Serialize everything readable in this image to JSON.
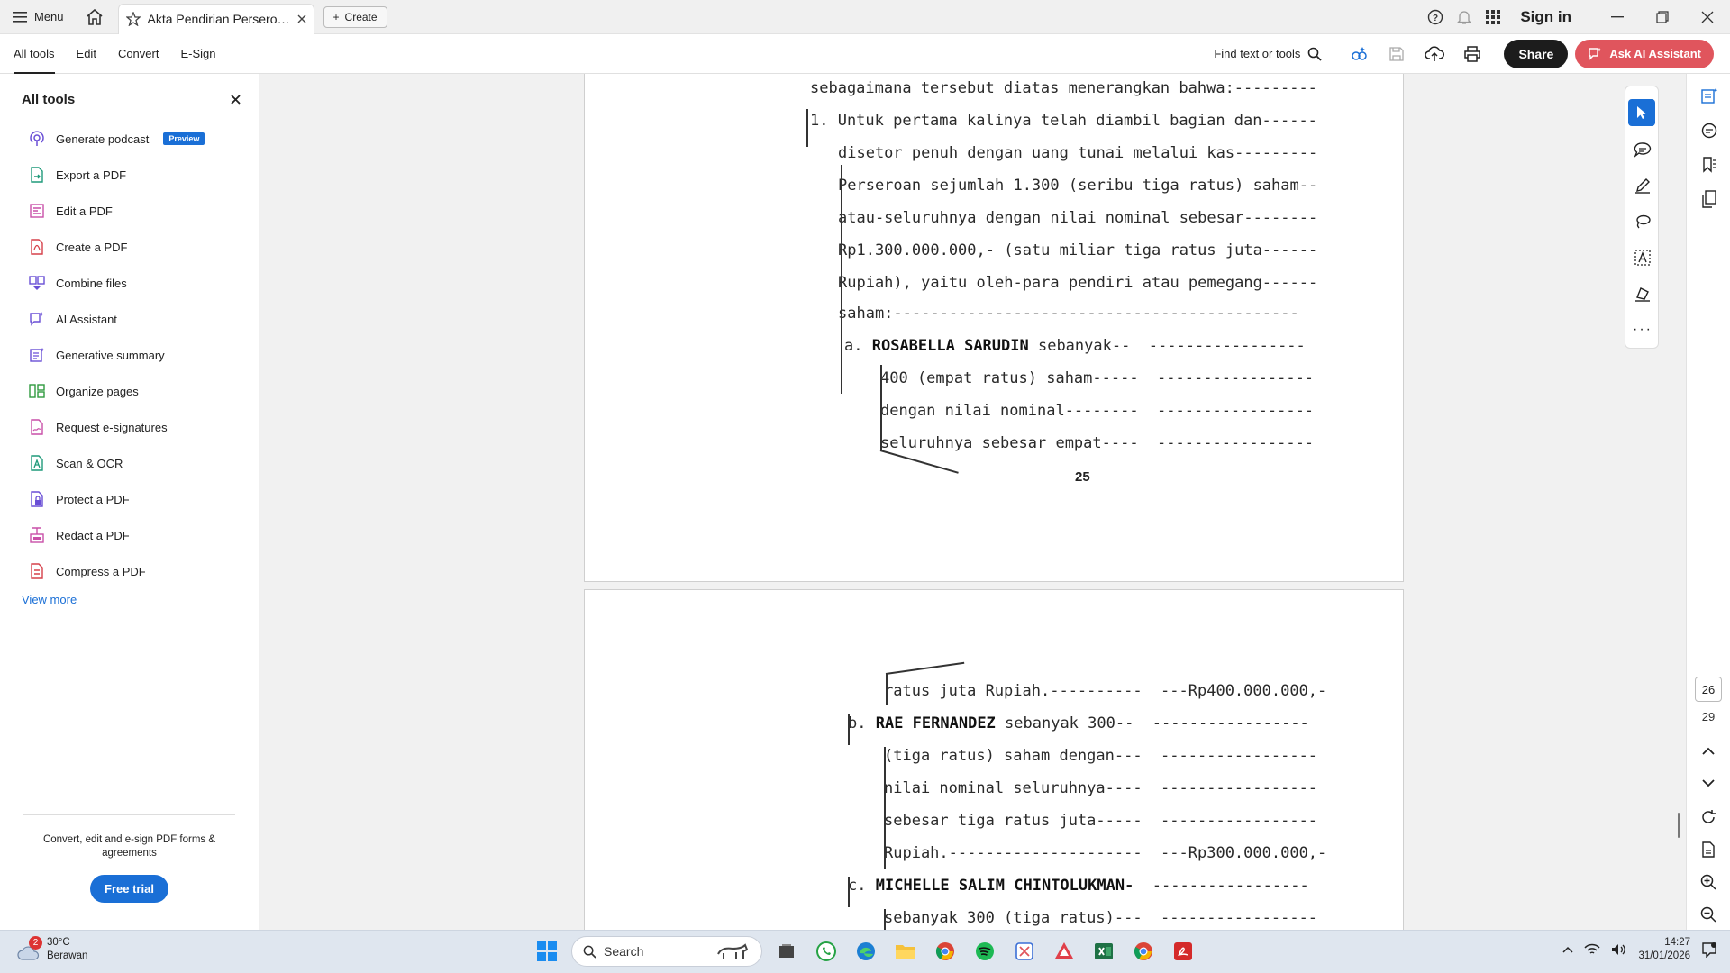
{
  "titlebar": {
    "menu_label": "Menu",
    "tab_title": "Akta Pendirian Perseroa...",
    "create_label": "Create",
    "signin_label": "Sign in"
  },
  "toolbar": {
    "tabs": [
      "All tools",
      "Edit",
      "Convert",
      "E-Sign"
    ],
    "find_label": "Find text or tools",
    "share_label": "Share",
    "ai_label": "Ask AI Assistant"
  },
  "sidebar": {
    "title": "All tools",
    "items": [
      {
        "label": "Generate podcast",
        "icon": "podcast-icon",
        "badge": "Preview"
      },
      {
        "label": "Export a PDF",
        "icon": "export-pdf-icon"
      },
      {
        "label": "Edit a PDF",
        "icon": "edit-pdf-icon"
      },
      {
        "label": "Create a PDF",
        "icon": "create-pdf-icon"
      },
      {
        "label": "Combine files",
        "icon": "combine-files-icon"
      },
      {
        "label": "AI Assistant",
        "icon": "ai-assistant-icon"
      },
      {
        "label": "Generative summary",
        "icon": "generative-summary-icon"
      },
      {
        "label": "Organize pages",
        "icon": "organize-pages-icon"
      },
      {
        "label": "Request e-signatures",
        "icon": "e-signature-icon"
      },
      {
        "label": "Scan & OCR",
        "icon": "scan-ocr-icon"
      },
      {
        "label": "Protect a PDF",
        "icon": "protect-pdf-icon"
      },
      {
        "label": "Redact a PDF",
        "icon": "redact-pdf-icon"
      },
      {
        "label": "Compress a PDF",
        "icon": "compress-pdf-icon"
      }
    ],
    "view_more": "View more",
    "promo_text": "Convert, edit and e-sign PDF forms & agreements",
    "free_trial": "Free trial"
  },
  "document": {
    "page1_lines": [
      "sebagaimana tersebut diatas menerangkan bahwa:---------",
      "1. Untuk pertama kalinya telah diambil bagian dan------",
      "disetor penuh dengan uang tunai melalui kas---------",
      "Perseroan sejumlah 1.300 (seribu tiga ratus) saham--",
      "atau-seluruhnya dengan nilai nominal sebesar--------",
      "Rp1.300.000.000,- (satu miliar tiga ratus juta------",
      "Rupiah), yaitu oleh-para pendiri atau pemegang------",
      "saham:--------------------------------------------",
      "a.",
      "ROSABELLA SARUDIN",
      " sebanyak--  -----------------",
      "400 (empat ratus) saham-----  -----------------",
      "dengan nilai nominal--------  -----------------",
      "seluruhnya sebesar empat----  -----------------"
    ],
    "page1_number": "25",
    "page2_lines": [
      "ratus juta Rupiah.----------  ---Rp400.000.000,-",
      "b.",
      "RAE FERNANDEZ",
      " sebanyak 300--  -----------------",
      "(tiga ratus) saham dengan---  -----------------",
      "nilai nominal seluruhnya----  -----------------",
      "sebesar tiga ratus juta-----  -----------------",
      "Rupiah.---------------------  ---Rp300.000.000,-",
      "c.",
      "MICHELLE SALIM CHINTOLUKMAN-",
      "  -----------------",
      "sebanyak 300 (tiga ratus)---  -----------------"
    ]
  },
  "pagenav": {
    "current": "26",
    "total": "29"
  },
  "taskbar": {
    "weather_temp": "30°C",
    "weather_desc": "Berawan",
    "weather_badge": "2",
    "search_label": "Search",
    "time": "14:27",
    "date": "31/01/2026"
  },
  "colors": {
    "accent": "#1a6fd6",
    "ai_button": "#e0555d",
    "share_button": "#1c1c1c"
  }
}
